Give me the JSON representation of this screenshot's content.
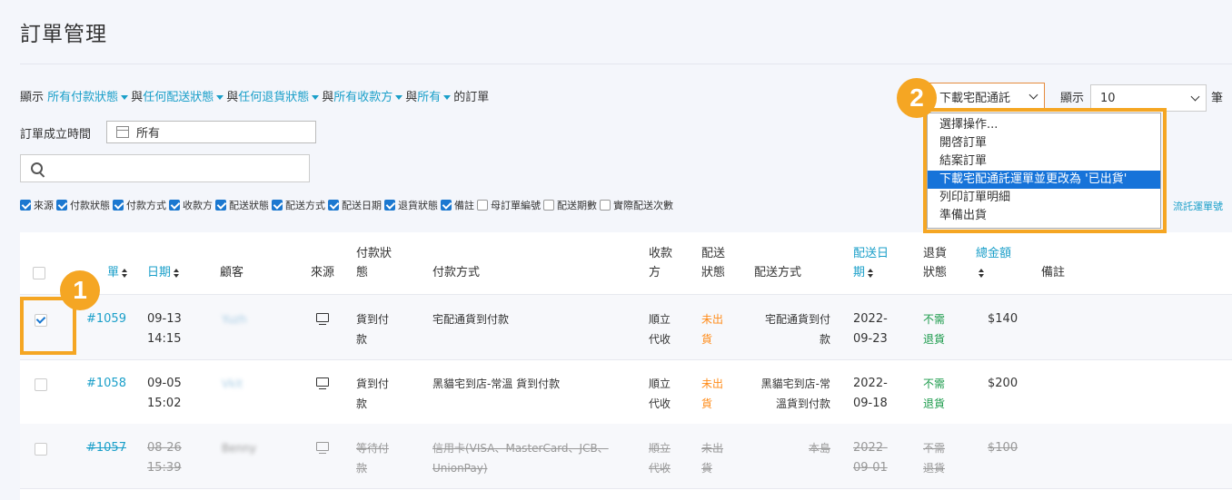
{
  "page": {
    "title": "訂單管理"
  },
  "filters": {
    "prefix": "顯示",
    "payment_status": "所有付款狀態",
    "and1": "與",
    "delivery_status": "任何配送狀態",
    "and2": "與",
    "return_status": "任何退貨狀態",
    "and3": "與",
    "payee": "所有收款方",
    "and4": "與",
    "all": "所有",
    "suffix": "的訂單"
  },
  "date_filter": {
    "label": "訂單成立時間",
    "value": "所有"
  },
  "search": {
    "placeholder": ""
  },
  "column_options": [
    {
      "label": "來源",
      "checked": true
    },
    {
      "label": "付款狀態",
      "checked": true
    },
    {
      "label": "付款方式",
      "checked": true
    },
    {
      "label": "收款方",
      "checked": true
    },
    {
      "label": "配送狀態",
      "checked": true
    },
    {
      "label": "配送方式",
      "checked": true
    },
    {
      "label": "配送日期",
      "checked": true
    },
    {
      "label": "退貨狀態",
      "checked": true
    },
    {
      "label": "備註",
      "checked": true
    },
    {
      "label": "母訂單編號",
      "checked": false
    },
    {
      "label": "配送期數",
      "checked": false
    },
    {
      "label": "實際配送次數",
      "checked": false
    }
  ],
  "tracking_link": "流託運單號",
  "actions": {
    "selected": "下載宅配通託",
    "options": [
      "選擇操作...",
      "開啓訂單",
      "結案訂單",
      "下載宅配通託運單並更改為 '已出貨'",
      "列印訂單明細",
      "準備出貨"
    ],
    "highlighted_index": 3
  },
  "page_size": {
    "label": "顯示",
    "value": "10",
    "unit": "筆"
  },
  "table": {
    "headers": {
      "order": "單",
      "date": "日期",
      "customer": "顧客",
      "source": "來源",
      "pay_status_1": "付款狀",
      "pay_status_2": "態",
      "pay_method": "付款方式",
      "payee_1": "收款",
      "payee_2": "方",
      "ship_status_1": "配送",
      "ship_status_2": "狀態",
      "ship_method": "配送方式",
      "ship_date_1": "配送日",
      "ship_date_2": "期",
      "return_1": "退貨",
      "return_2": "狀態",
      "total": "總金額",
      "note": "備註"
    },
    "rows": [
      {
        "id": "#1059",
        "date": "09-13",
        "time": "14:15",
        "customer": "Yuzh",
        "pay_status_1": "貨到付",
        "pay_status_2": "款",
        "pay_method": "宅配通貨到付款",
        "pay_method_2": "",
        "payee_1": "順立",
        "payee_2": "代收",
        "ship_status_1": "未出",
        "ship_status_2": "貨",
        "ship_method_1": "宅配通貨到付",
        "ship_method_2": "款",
        "ship_date_1": "2022-",
        "ship_date_2": "09-23",
        "return_1": "不需",
        "return_2": "退貨",
        "total": "$140",
        "checked": true
      },
      {
        "id": "#1058",
        "date": "09-05",
        "time": "15:02",
        "customer": "Vkit",
        "pay_status_1": "貨到付",
        "pay_status_2": "款",
        "pay_method": "黑貓宅到店-常溫 貨到付款",
        "pay_method_2": "",
        "payee_1": "順立",
        "payee_2": "代收",
        "ship_status_1": "未出",
        "ship_status_2": "貨",
        "ship_method_1": "黑貓宅到店-常",
        "ship_method_2": "溫貨到付款",
        "ship_date_1": "2022-",
        "ship_date_2": "09-18",
        "return_1": "不需",
        "return_2": "退貨",
        "total": "$200",
        "checked": false
      },
      {
        "id": "#1057",
        "date": "08-26",
        "time": "15:39",
        "customer": "Benny",
        "pay_status_1": "等待付",
        "pay_status_2": "款",
        "pay_method": "信用卡(VISA、MasterCard、JCB、",
        "pay_method_2": "UnionPay)",
        "payee_1": "順立",
        "payee_2": "代收",
        "ship_status_1": "未出",
        "ship_status_2": "貨",
        "ship_method_1": "本島",
        "ship_method_2": "",
        "ship_date_1": "2022-",
        "ship_date_2": "09-01",
        "return_1": "不需",
        "return_2": "退貨",
        "total": "$100",
        "checked": false
      }
    ]
  },
  "callouts": {
    "one": "1",
    "two": "2"
  },
  "colors": {
    "accent": "#1a9fc9",
    "highlight": "#f5a623",
    "warning": "#ff8c1a",
    "ok": "#1a9a4a",
    "selection": "#1673d9"
  }
}
